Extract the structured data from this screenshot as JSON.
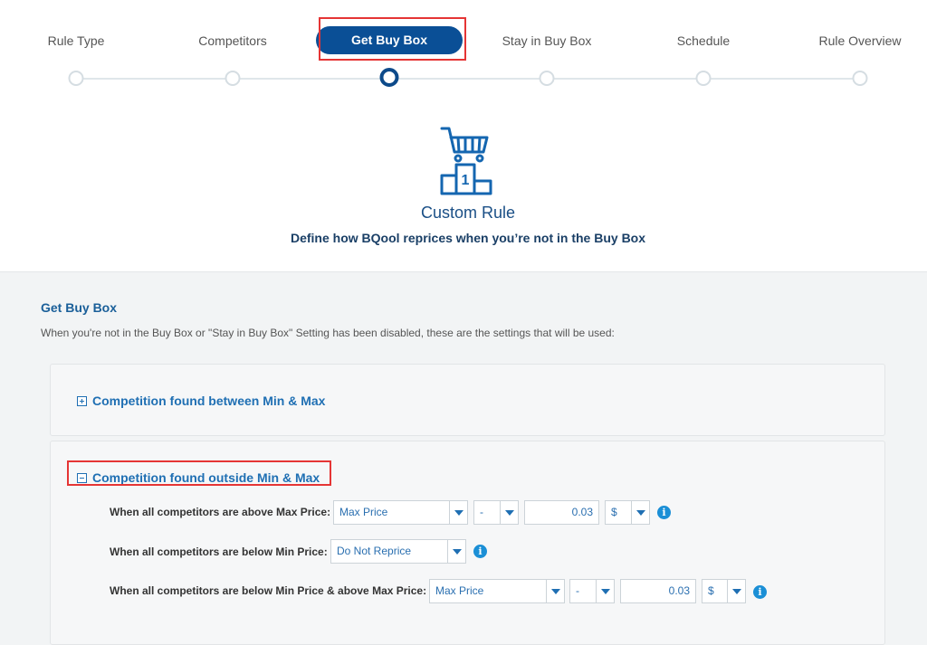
{
  "stepper": {
    "steps": [
      {
        "label": "Rule Type"
      },
      {
        "label": "Competitors"
      },
      {
        "label": "Get Buy Box"
      },
      {
        "label": "Stay in Buy Box"
      },
      {
        "label": "Schedule"
      },
      {
        "label": "Rule Overview"
      }
    ],
    "active_index": 2
  },
  "hero": {
    "icon": "cart-podium-icon",
    "title": "Custom Rule",
    "subtitle": "Define how BQool reprices when you’re not in the Buy Box"
  },
  "section": {
    "title": "Get Buy Box",
    "description": "When you're not in the Buy Box or \"Stay in Buy Box\" Setting has been disabled, these are the settings that will be used:"
  },
  "panels": {
    "between": {
      "title": "Competition found between Min & Max",
      "state": "collapsed"
    },
    "outside": {
      "title": "Competition found outside Min & Max",
      "state": "expanded",
      "rows": [
        {
          "label": "When all competitors are above Max Price:",
          "price_select": "Max Price",
          "op_select": "-",
          "amount": "0.03",
          "unit_select": "$"
        },
        {
          "label": "When all competitors are below Min Price:",
          "price_select": "Do Not Reprice"
        },
        {
          "label": "When all competitors are below Min Price & above Max Price:",
          "price_select": "Max Price",
          "op_select": "-",
          "amount": "0.03",
          "unit_select": "$"
        }
      ]
    }
  },
  "colors": {
    "accent": "#0a4f96",
    "link": "#1f6fb3",
    "highlight": "#e53535",
    "info": "#1b8fd6"
  }
}
